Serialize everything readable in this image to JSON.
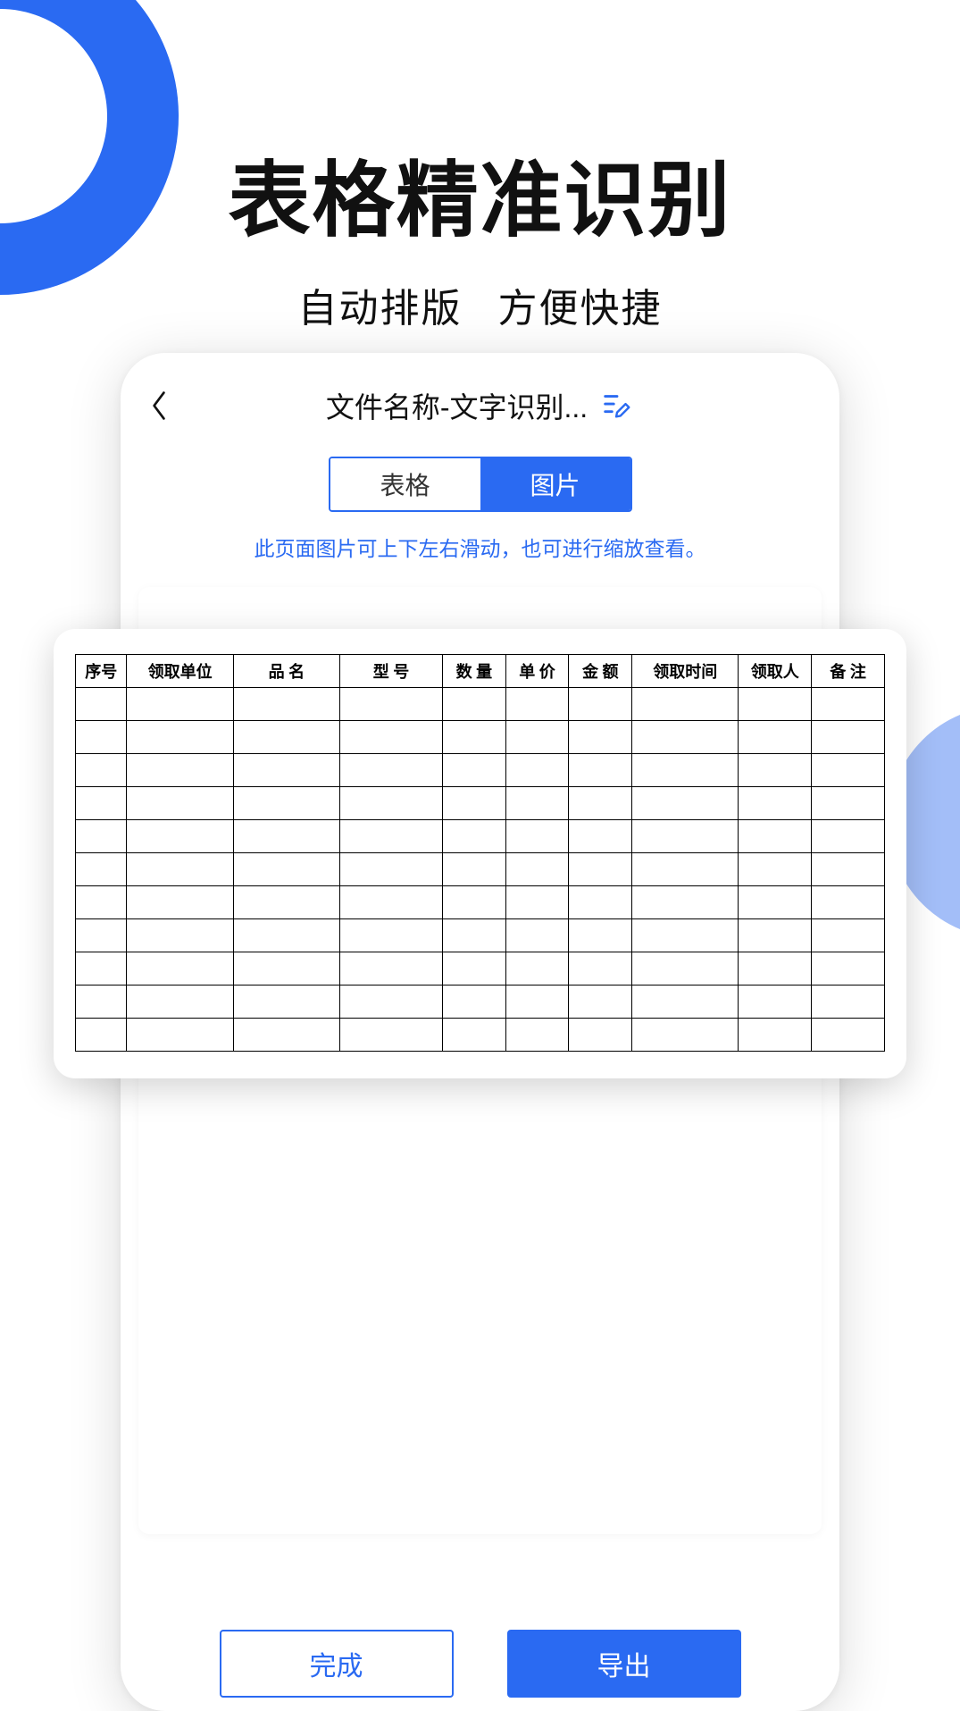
{
  "hero": {
    "title": "表格精准识别",
    "sub_a": "自动排版",
    "sub_b": "方便快捷"
  },
  "app": {
    "header": {
      "title": "文件名称-文字识别..."
    },
    "tabs": {
      "table": "表格",
      "image": "图片",
      "active": "image"
    },
    "hint": "此页面图片可上下左右滑动，也可进行缩放查看。",
    "actions": {
      "done": "完成",
      "export": "导出"
    }
  },
  "chart_data": {
    "type": "table",
    "columns": [
      "序号",
      "领取单位",
      "品 名",
      "型 号",
      "数 量",
      "单 价",
      "金 额",
      "领取时间",
      "领取人",
      "备 注"
    ],
    "rows": [
      [
        "",
        "",
        "",
        "",
        "",
        "",
        "",
        "",
        "",
        ""
      ],
      [
        "",
        "",
        "",
        "",
        "",
        "",
        "",
        "",
        "",
        ""
      ],
      [
        "",
        "",
        "",
        "",
        "",
        "",
        "",
        "",
        "",
        ""
      ],
      [
        "",
        "",
        "",
        "",
        "",
        "",
        "",
        "",
        "",
        ""
      ],
      [
        "",
        "",
        "",
        "",
        "",
        "",
        "",
        "",
        "",
        ""
      ],
      [
        "",
        "",
        "",
        "",
        "",
        "",
        "",
        "",
        "",
        ""
      ],
      [
        "",
        "",
        "",
        "",
        "",
        "",
        "",
        "",
        "",
        ""
      ],
      [
        "",
        "",
        "",
        "",
        "",
        "",
        "",
        "",
        "",
        ""
      ],
      [
        "",
        "",
        "",
        "",
        "",
        "",
        "",
        "",
        "",
        ""
      ],
      [
        "",
        "",
        "",
        "",
        "",
        "",
        "",
        "",
        "",
        ""
      ],
      [
        "",
        "",
        "",
        "",
        "",
        "",
        "",
        "",
        "",
        ""
      ]
    ]
  }
}
